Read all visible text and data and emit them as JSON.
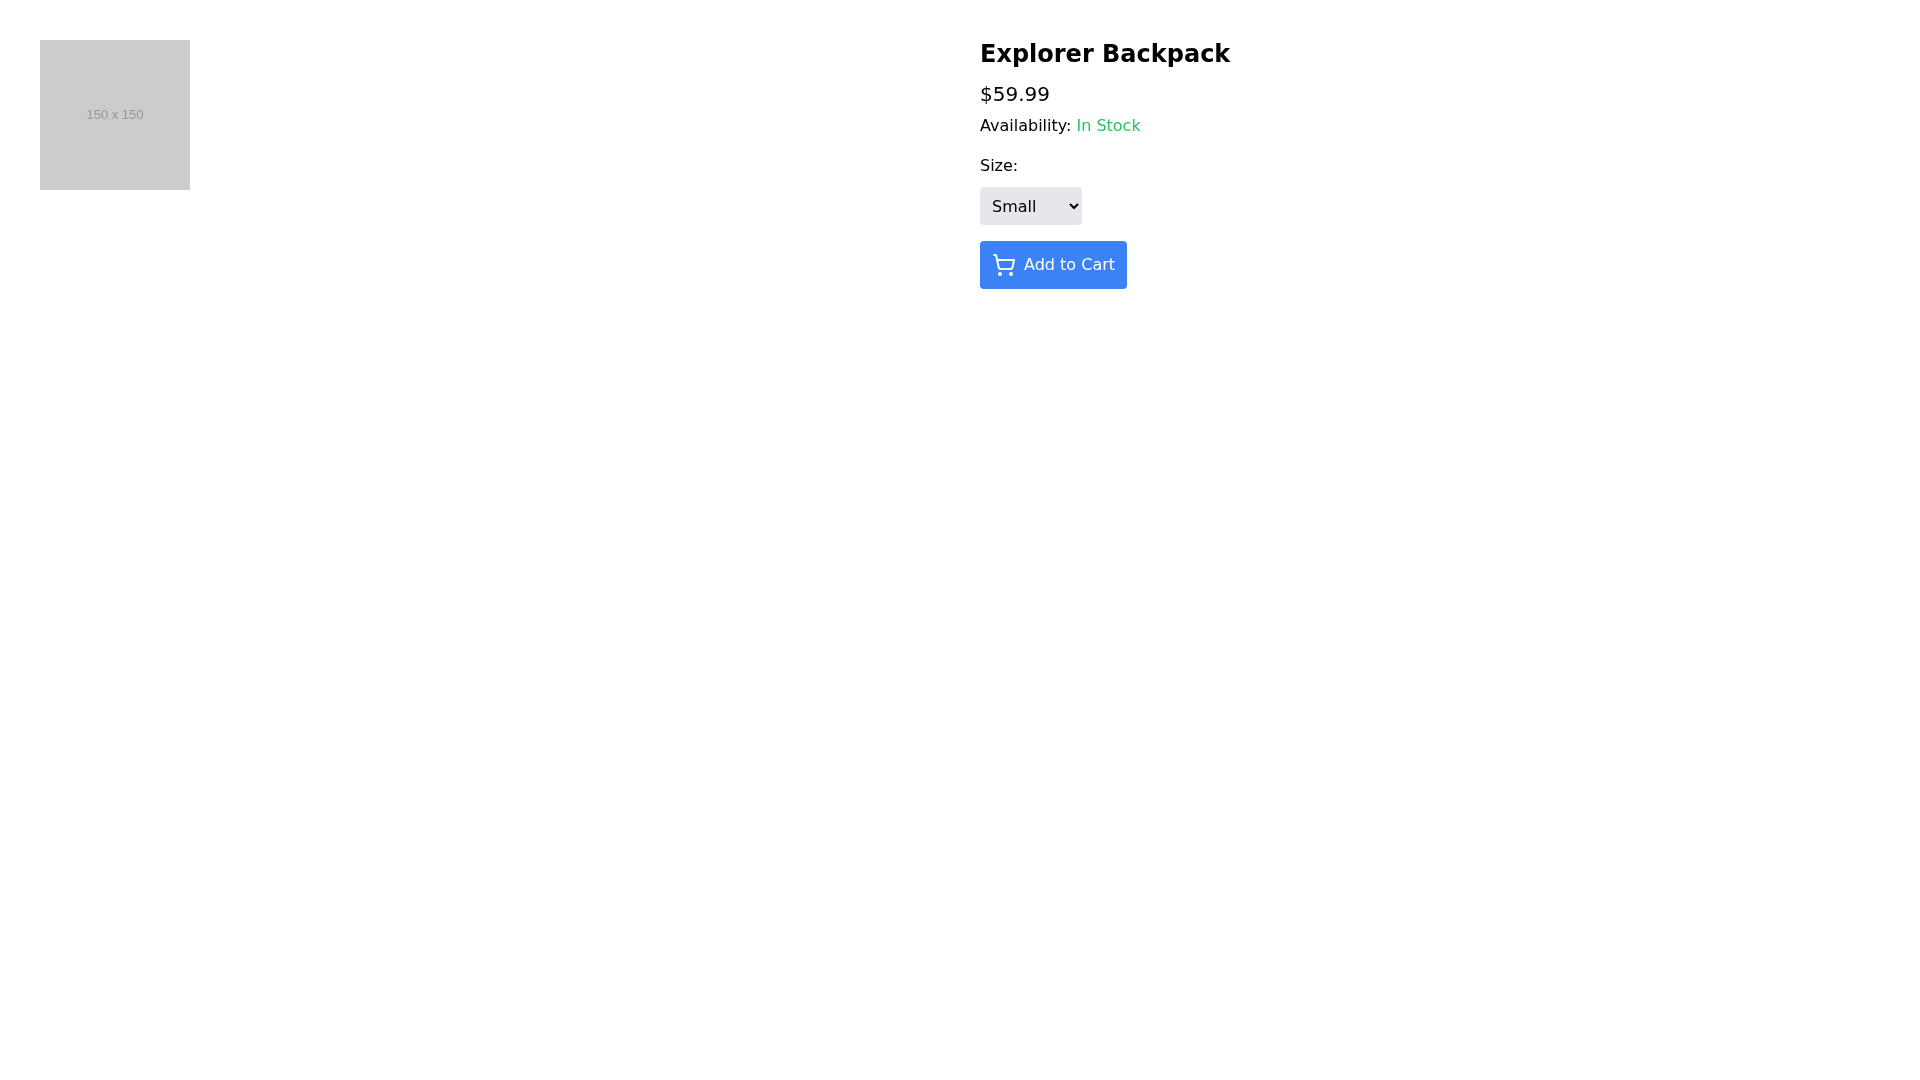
{
  "image": {
    "label": "150 x 150"
  },
  "product": {
    "title": "Explorer Backpack",
    "price": "$59.99",
    "availability_label": "Availability:",
    "availability": "In Stock",
    "in_stock": true
  },
  "size": {
    "label": "Size:",
    "value": "Small"
  },
  "add_to_cart": {
    "label": "Add to Cart"
  }
}
